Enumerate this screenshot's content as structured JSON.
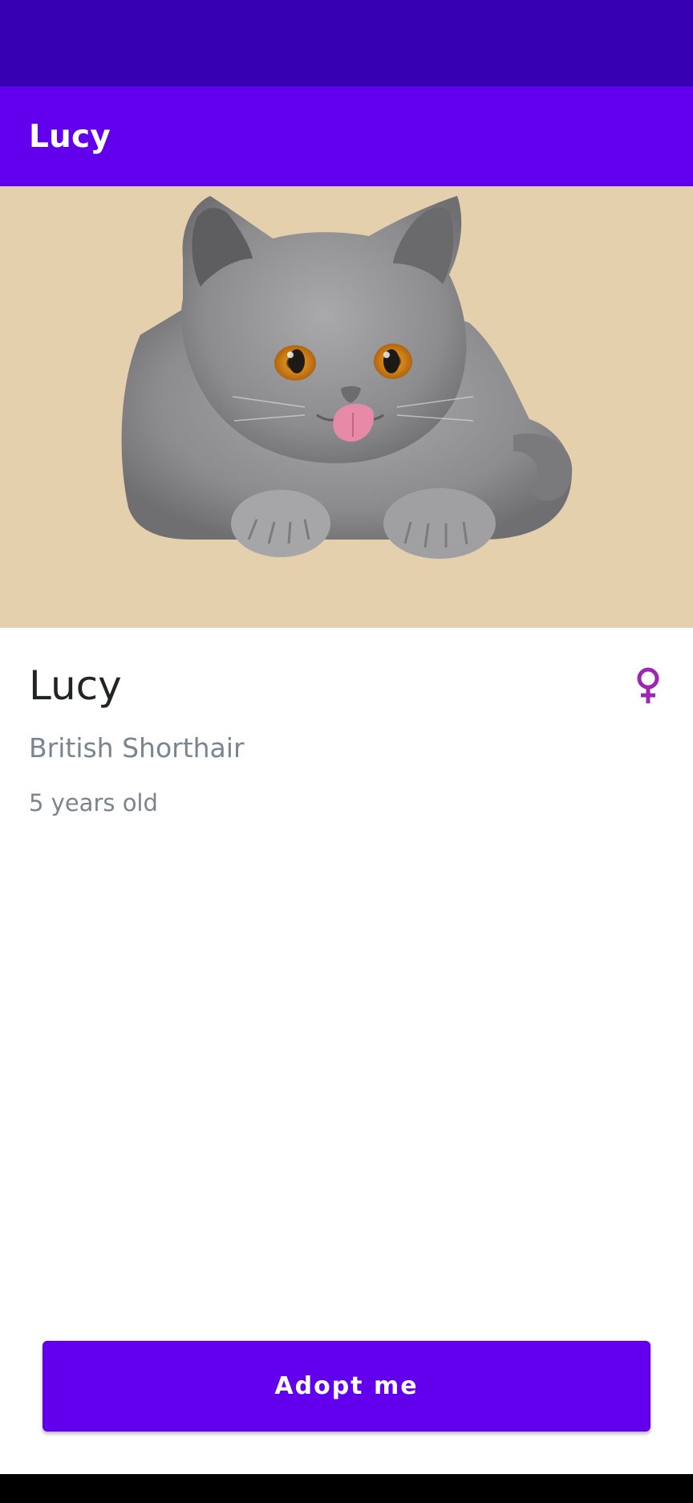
{
  "status_bar": {},
  "app_bar": {
    "title": "Lucy"
  },
  "hero": {
    "image_subject": "gray British Shorthair cat licking lips",
    "background_color": "#e5d0ad"
  },
  "pet": {
    "name": "Lucy",
    "breed": "British Shorthair",
    "age": "5 years old",
    "gender_icon": "female-icon"
  },
  "actions": {
    "adopt_label": "Adopt me"
  },
  "colors": {
    "status_bar": "#3700b3",
    "primary": "#6200ee",
    "gender_icon": "#9c27b0"
  }
}
